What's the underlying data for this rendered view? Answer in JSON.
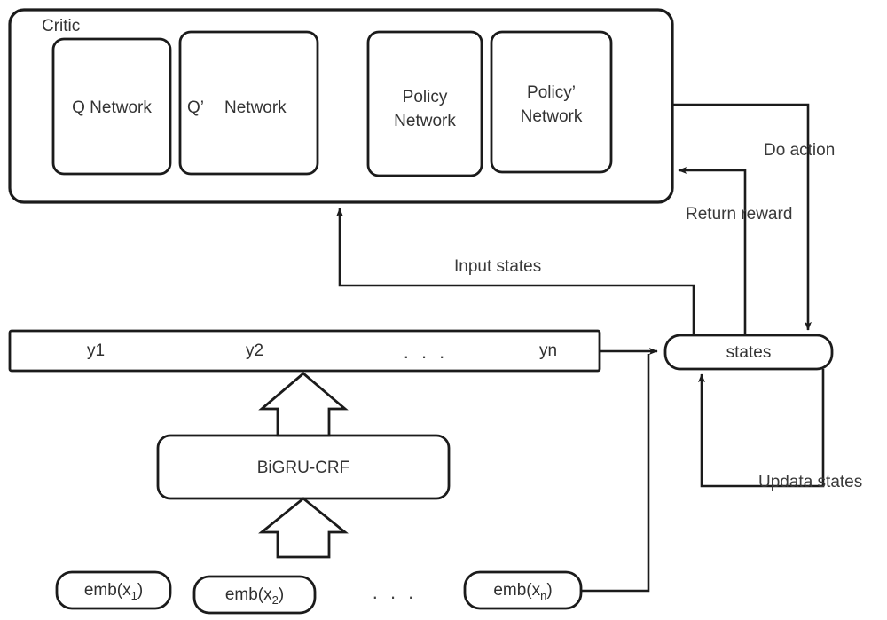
{
  "diagram": {
    "title": "Actor-Critic sequence labeling architecture",
    "colors": {
      "stroke": "#1b1b1b",
      "fill": "#ffffff",
      "text": "#333333"
    }
  },
  "critic": {
    "label": "Critic",
    "networks": [
      {
        "label": "Q Network"
      },
      {
        "label": "Q’   Network"
      },
      {
        "label": "Policy\nNetwork"
      },
      {
        "label": "Policy’\nNetwork"
      }
    ],
    "network_labels": {
      "q": "Q Network",
      "q_target_a": "Q’",
      "q_target_b": "Network",
      "policy_a": "Policy",
      "policy_b": "Network",
      "policy_target_a": "Policy’",
      "policy_target_b": "Network"
    }
  },
  "sequence": {
    "items": [
      "y1",
      "y2",
      ". . .",
      "yn"
    ],
    "y1": "y1",
    "y2": "y2",
    "ellipsis": ". . .",
    "yn": "yn"
  },
  "encoder": {
    "label": "BiGRU-CRF"
  },
  "states": {
    "label": "states"
  },
  "embeddings": {
    "items": [
      {
        "prefix": "emb(x",
        "sub": "1",
        "suffix": ")"
      },
      {
        "prefix": "emb(x",
        "sub": "2",
        "suffix": ")"
      },
      {
        "prefix": "emb(x",
        "sub": "n",
        "suffix": ")"
      }
    ],
    "ellipsis": ". . .",
    "e1_prefix": "emb(x",
    "e1_sub": "1",
    "e1_suffix": ")",
    "e2_prefix": "emb(x",
    "e2_sub": "2",
    "e2_suffix": ")",
    "en_prefix": "emb(x",
    "en_sub": "n",
    "en_suffix": ")"
  },
  "edges": {
    "do_action": "Do action",
    "return_reward": "Return reward",
    "input_states": "Input states",
    "update_states": "Updata states"
  }
}
